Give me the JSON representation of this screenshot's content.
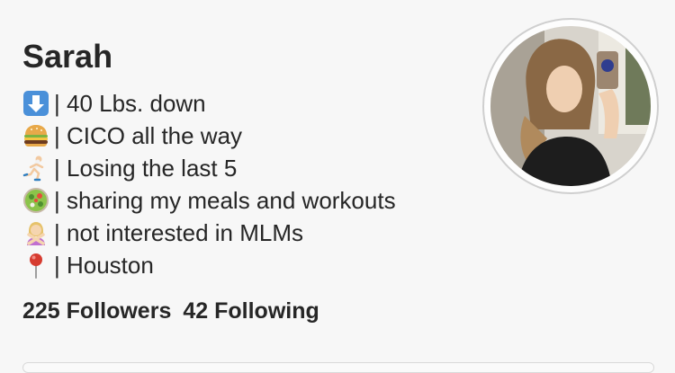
{
  "profile": {
    "name": "Sarah",
    "bio": [
      {
        "icon": "down-arrow-icon",
        "text": "| 40 Lbs. down"
      },
      {
        "icon": "hamburger-icon",
        "text": "| CICO all the way"
      },
      {
        "icon": "runner-icon",
        "text": "| Losing the last 5"
      },
      {
        "icon": "salad-icon",
        "text": "| sharing my meals and workouts"
      },
      {
        "icon": "person-gesturing-no-icon",
        "text": "| not interested in MLMs"
      },
      {
        "icon": "round-pushpin-icon",
        "text": "| Houston"
      }
    ],
    "stats": {
      "followers": "225 Followers",
      "following": "42 Following"
    }
  },
  "colors": {
    "background": "#f7f7f7",
    "text": "#262626",
    "avatar_ring": "#cfcfcf"
  }
}
